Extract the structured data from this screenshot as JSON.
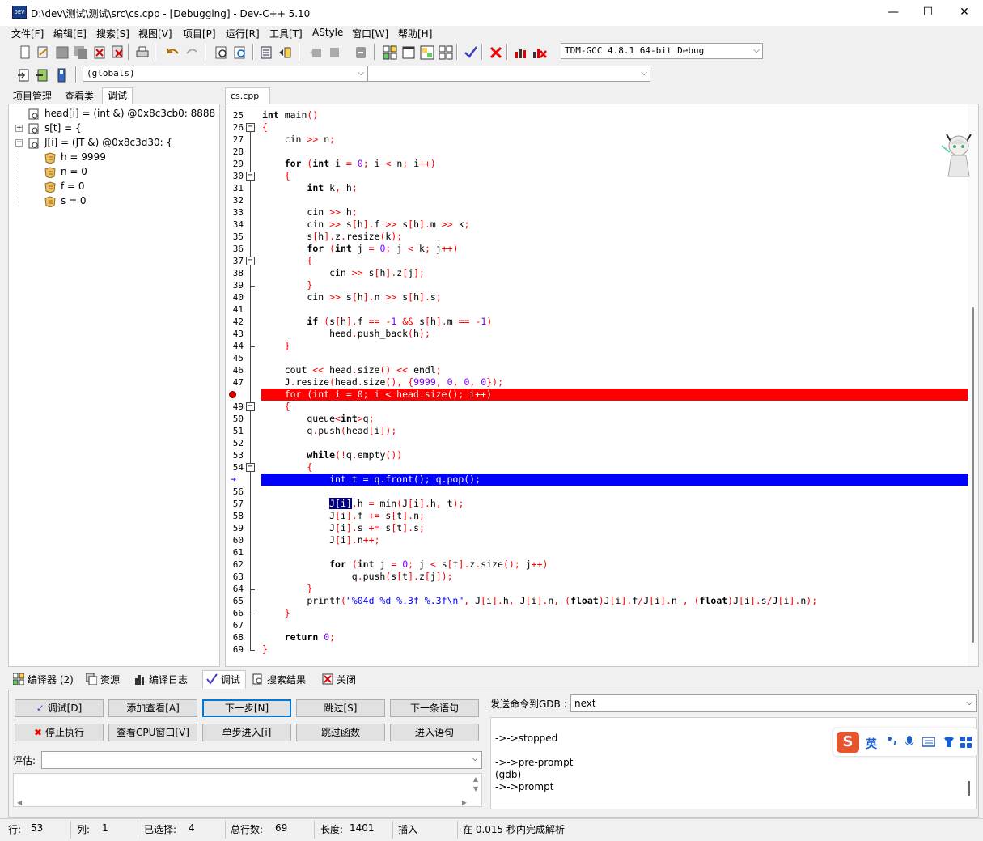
{
  "window": {
    "title": "D:\\dev\\测试\\测试\\src\\cs.cpp - [Debugging] - Dev-C++ 5.10",
    "app_icon": "DEV",
    "minimize": "—",
    "maximize": "☐",
    "close": "✕"
  },
  "menu": [
    "文件[F]",
    "编辑[E]",
    "搜索[S]",
    "视图[V]",
    "项目[P]",
    "运行[R]",
    "工具[T]",
    "AStyle",
    "窗口[W]",
    "帮助[H]"
  ],
  "toolbar": {
    "compiler_select": "TDM-GCC 4.8.1 64-bit Debug",
    "scope_select": "(globals)",
    "member_select": ""
  },
  "left_panel": {
    "tabs": [
      "项目管理",
      "查看类",
      "调试"
    ],
    "active_tab": "调试",
    "tree": [
      {
        "text": "head[i] = (int &) @0x8c3cb0: 8888",
        "level": 0,
        "expander": ""
      },
      {
        "text": "s[t] = {",
        "level": 0,
        "expander": "+"
      },
      {
        "text": "J[i] = (JT &) @0x8c3d30: {",
        "level": 0,
        "expander": "−"
      },
      {
        "text": "h = 9999",
        "level": 1,
        "expander": ""
      },
      {
        "text": "n = 0",
        "level": 1,
        "expander": ""
      },
      {
        "text": "f = 0",
        "level": 1,
        "expander": ""
      },
      {
        "text": "s = 0",
        "level": 1,
        "expander": ""
      }
    ]
  },
  "editor": {
    "file_tab": "cs.cpp",
    "breakpoint_line": 48,
    "current_line": 55,
    "selected_token": "J[i]",
    "lines": [
      {
        "n": "25",
        "t": "int main()"
      },
      {
        "n": "26",
        "t": "{"
      },
      {
        "n": "27",
        "t": "    cin >> n;"
      },
      {
        "n": "28",
        "t": ""
      },
      {
        "n": "29",
        "t": "    for (int i = 0; i < n; i++)"
      },
      {
        "n": "30",
        "t": "    {"
      },
      {
        "n": "31",
        "t": "        int k, h;"
      },
      {
        "n": "32",
        "t": ""
      },
      {
        "n": "33",
        "t": "        cin >> h;"
      },
      {
        "n": "34",
        "t": "        cin >> s[h].f >> s[h].m >> k;"
      },
      {
        "n": "35",
        "t": "        s[h].z.resize(k);"
      },
      {
        "n": "36",
        "t": "        for (int j = 0; j < k; j++)"
      },
      {
        "n": "37",
        "t": "        {"
      },
      {
        "n": "38",
        "t": "            cin >> s[h].z[j];"
      },
      {
        "n": "39",
        "t": "        }"
      },
      {
        "n": "40",
        "t": "        cin >> s[h].n >> s[h].s;"
      },
      {
        "n": "41",
        "t": ""
      },
      {
        "n": "42",
        "t": "        if (s[h].f == -1 && s[h].m == -1)"
      },
      {
        "n": "43",
        "t": "            head.push_back(h);"
      },
      {
        "n": "44",
        "t": "    }"
      },
      {
        "n": "45",
        "t": ""
      },
      {
        "n": "46",
        "t": "    cout << head.size() << endl;"
      },
      {
        "n": "47",
        "t": "    J.resize(head.size(), {9999, 0, 0, 0});"
      },
      {
        "n": "48",
        "t": "    for (int i = 0; i < head.size(); i++)"
      },
      {
        "n": "49",
        "t": "    {"
      },
      {
        "n": "50",
        "t": "        queue<int>q;"
      },
      {
        "n": "51",
        "t": "        q.push(head[i]);"
      },
      {
        "n": "52",
        "t": ""
      },
      {
        "n": "53",
        "t": "        while(!q.empty())"
      },
      {
        "n": "54",
        "t": "        {"
      },
      {
        "n": "55",
        "t": "            int t = q.front(); q.pop();"
      },
      {
        "n": "56",
        "t": ""
      },
      {
        "n": "57",
        "t": "            J[i].h = min(J[i].h, t);"
      },
      {
        "n": "58",
        "t": "            J[i].f += s[t].n;"
      },
      {
        "n": "59",
        "t": "            J[i].s += s[t].s;"
      },
      {
        "n": "60",
        "t": "            J[i].n++;"
      },
      {
        "n": "61",
        "t": ""
      },
      {
        "n": "62",
        "t": "            for (int j = 0; j < s[t].z.size(); j++)"
      },
      {
        "n": "63",
        "t": "                q.push(s[t].z[j]);"
      },
      {
        "n": "64",
        "t": "        }"
      },
      {
        "n": "65",
        "t": "        printf(\"%04d %d %.3f %.3f\\n\", J[i].h, J[i].n, (float)J[i].f/J[i].n , (float)J[i].s/J[i].n);"
      },
      {
        "n": "66",
        "t": "    }"
      },
      {
        "n": "67",
        "t": ""
      },
      {
        "n": "68",
        "t": "    return 0;"
      },
      {
        "n": "69",
        "t": "}"
      }
    ]
  },
  "bottom_tabs": [
    {
      "label": "编译器 (2)",
      "icon": "grid-icon"
    },
    {
      "label": "资源",
      "icon": "resource-icon"
    },
    {
      "label": "编译日志",
      "icon": "chart-icon"
    },
    {
      "label": "调试",
      "icon": "check-icon"
    },
    {
      "label": "搜索结果",
      "icon": "search-icon"
    },
    {
      "label": "关闭",
      "icon": "close-icon"
    }
  ],
  "debug_buttons": {
    "debug": "调试[D]",
    "add_watch": "添加查看[A]",
    "next_step": "下一步[N]",
    "skip": "跳过[S]",
    "next_statement": "下一条语句",
    "stop": "停止执行",
    "cpu_window": "查看CPU窗口[V]",
    "step_into": "单步进入[i]",
    "skip_function": "跳过函数",
    "into_statement": "进入语句"
  },
  "eval_label": "评估:",
  "gdb": {
    "label": "发送命令到GDB :",
    "command": "next",
    "log": [
      "->->stopped",
      "",
      "->->pre-prompt",
      "(gdb)",
      "->->prompt"
    ]
  },
  "ime": {
    "logo": "S",
    "mode": "英",
    "punct": "•,"
  },
  "status": {
    "row_label": "行:",
    "row": "53",
    "col_label": "列:",
    "col": "1",
    "sel_label": "已选择:",
    "sel": "4",
    "total_label": "总行数:",
    "total": "69",
    "len_label": "长度:",
    "len": "1401",
    "mode": "插入",
    "parse": "在 0.015 秒内完成解析"
  },
  "colors": {
    "breakpoint": "#ff0000",
    "current": "#0000ff",
    "accent": "#0078d7"
  }
}
